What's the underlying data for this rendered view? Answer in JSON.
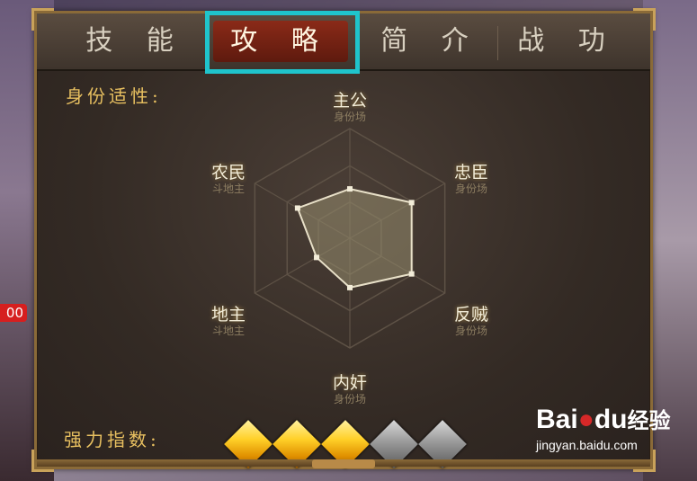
{
  "tabs": [
    {
      "label": "技 能",
      "active": false
    },
    {
      "label": "攻 略",
      "active": true
    },
    {
      "label": "简 介",
      "active": false
    },
    {
      "label": "战 功",
      "active": false
    }
  ],
  "side_badge": "00",
  "suitability_label": "身份适性:",
  "power_label": "强力指数:",
  "roles": [
    {
      "name": "主公",
      "sub": "身份场"
    },
    {
      "name": "忠臣",
      "sub": "身份场"
    },
    {
      "name": "反贼",
      "sub": "身份场"
    },
    {
      "name": "内奸",
      "sub": "身份场"
    },
    {
      "name": "地主",
      "sub": "斗地主"
    },
    {
      "name": "农民",
      "sub": "斗地主"
    }
  ],
  "radar_values": [
    0.45,
    0.65,
    0.65,
    0.45,
    0.35,
    0.55
  ],
  "power_rating": {
    "filled": 3,
    "total": 5
  },
  "colors": {
    "accent_gold": "#e8c060",
    "active_tab": "#8a2a18",
    "highlight": "#1fc4cc"
  },
  "watermark": {
    "brand_a": "Bai",
    "brand_b": "du",
    "brand_c": "经验",
    "url": "jingyan.baidu.com"
  }
}
